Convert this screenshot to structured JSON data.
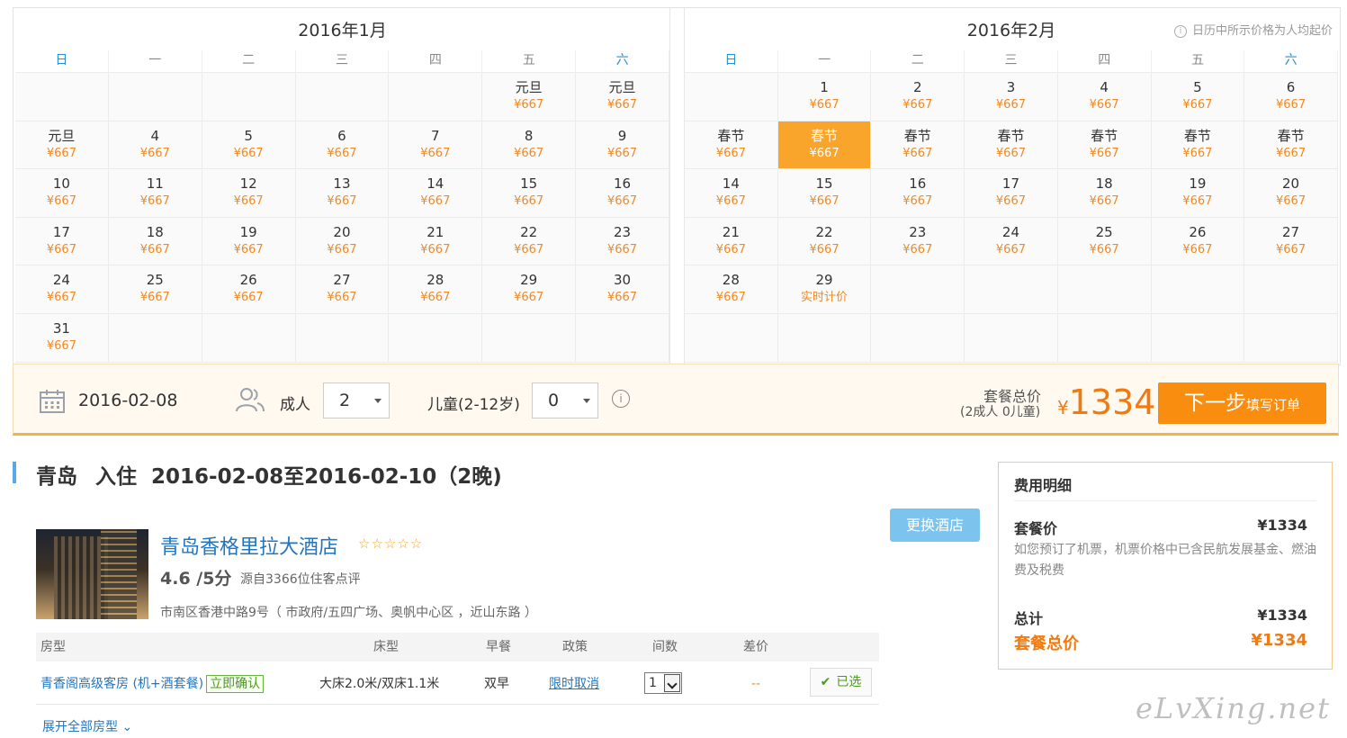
{
  "calendar": {
    "note": "日历中所示价格为人均起价",
    "weekdays": [
      "日",
      "一",
      "二",
      "三",
      "四",
      "五",
      "六"
    ],
    "months": [
      {
        "title": "2016年1月",
        "cells": [
          {
            "d": "",
            "p": ""
          },
          {
            "d": "",
            "p": ""
          },
          {
            "d": "",
            "p": ""
          },
          {
            "d": "",
            "p": ""
          },
          {
            "d": "",
            "p": ""
          },
          {
            "d": "元旦",
            "p": "¥667"
          },
          {
            "d": "元旦",
            "p": "¥667"
          },
          {
            "d": "元旦",
            "p": "¥667"
          },
          {
            "d": "4",
            "p": "¥667"
          },
          {
            "d": "5",
            "p": "¥667"
          },
          {
            "d": "6",
            "p": "¥667"
          },
          {
            "d": "7",
            "p": "¥667"
          },
          {
            "d": "8",
            "p": "¥667"
          },
          {
            "d": "9",
            "p": "¥667"
          },
          {
            "d": "10",
            "p": "¥667"
          },
          {
            "d": "11",
            "p": "¥667"
          },
          {
            "d": "12",
            "p": "¥667"
          },
          {
            "d": "13",
            "p": "¥667"
          },
          {
            "d": "14",
            "p": "¥667"
          },
          {
            "d": "15",
            "p": "¥667"
          },
          {
            "d": "16",
            "p": "¥667"
          },
          {
            "d": "17",
            "p": "¥667"
          },
          {
            "d": "18",
            "p": "¥667"
          },
          {
            "d": "19",
            "p": "¥667"
          },
          {
            "d": "20",
            "p": "¥667"
          },
          {
            "d": "21",
            "p": "¥667"
          },
          {
            "d": "22",
            "p": "¥667"
          },
          {
            "d": "23",
            "p": "¥667"
          },
          {
            "d": "24",
            "p": "¥667"
          },
          {
            "d": "25",
            "p": "¥667"
          },
          {
            "d": "26",
            "p": "¥667"
          },
          {
            "d": "27",
            "p": "¥667"
          },
          {
            "d": "28",
            "p": "¥667"
          },
          {
            "d": "29",
            "p": "¥667"
          },
          {
            "d": "30",
            "p": "¥667"
          },
          {
            "d": "31",
            "p": "¥667"
          },
          {
            "d": "",
            "p": ""
          },
          {
            "d": "",
            "p": ""
          },
          {
            "d": "",
            "p": ""
          },
          {
            "d": "",
            "p": ""
          },
          {
            "d": "",
            "p": ""
          },
          {
            "d": "",
            "p": ""
          }
        ]
      },
      {
        "title": "2016年2月",
        "cells": [
          {
            "d": "",
            "p": ""
          },
          {
            "d": "1",
            "p": "¥667"
          },
          {
            "d": "2",
            "p": "¥667"
          },
          {
            "d": "3",
            "p": "¥667"
          },
          {
            "d": "4",
            "p": "¥667"
          },
          {
            "d": "5",
            "p": "¥667"
          },
          {
            "d": "6",
            "p": "¥667"
          },
          {
            "d": "春节",
            "p": "¥667"
          },
          {
            "d": "春节",
            "p": "¥667",
            "selected": true
          },
          {
            "d": "春节",
            "p": "¥667"
          },
          {
            "d": "春节",
            "p": "¥667"
          },
          {
            "d": "春节",
            "p": "¥667"
          },
          {
            "d": "春节",
            "p": "¥667"
          },
          {
            "d": "春节",
            "p": "¥667"
          },
          {
            "d": "14",
            "p": "¥667"
          },
          {
            "d": "15",
            "p": "¥667"
          },
          {
            "d": "16",
            "p": "¥667"
          },
          {
            "d": "17",
            "p": "¥667"
          },
          {
            "d": "18",
            "p": "¥667"
          },
          {
            "d": "19",
            "p": "¥667"
          },
          {
            "d": "20",
            "p": "¥667"
          },
          {
            "d": "21",
            "p": "¥667"
          },
          {
            "d": "22",
            "p": "¥667"
          },
          {
            "d": "23",
            "p": "¥667"
          },
          {
            "d": "24",
            "p": "¥667"
          },
          {
            "d": "25",
            "p": "¥667"
          },
          {
            "d": "26",
            "p": "¥667"
          },
          {
            "d": "27",
            "p": "¥667"
          },
          {
            "d": "28",
            "p": "¥667"
          },
          {
            "d": "29",
            "p": "实时计价"
          },
          {
            "d": "",
            "p": ""
          },
          {
            "d": "",
            "p": ""
          },
          {
            "d": "",
            "p": ""
          },
          {
            "d": "",
            "p": ""
          },
          {
            "d": "",
            "p": ""
          },
          {
            "d": "",
            "p": ""
          },
          {
            "d": "",
            "p": ""
          },
          {
            "d": "",
            "p": ""
          },
          {
            "d": "",
            "p": ""
          },
          {
            "d": "",
            "p": ""
          },
          {
            "d": "",
            "p": ""
          },
          {
            "d": "",
            "p": ""
          }
        ]
      }
    ]
  },
  "booking": {
    "date": "2016-02-08",
    "adult_label": "成人",
    "adult_value": "2",
    "child_label": "儿童(2-12岁)",
    "child_value": "0",
    "total_label": "套餐总价",
    "total_sub": "(2成人 0儿童)",
    "currency": "¥",
    "total_price": "1334",
    "next_label": "下一步",
    "next_sub": "填写订单"
  },
  "hotel_section": {
    "city": "青岛",
    "checkin_label": "入住",
    "dates": "2016-02-08至2016-02-10（2晚)",
    "hotel_name": "青岛香格里拉大酒店",
    "stars": "☆☆☆☆☆",
    "score": "4.6 /5分",
    "reviews": "源自3366位住客点评",
    "address": "市南区香港中路9号（ 市政府/五四广场、奥帆中心区 ，近山东路 ）",
    "change_label": "更换酒店",
    "table_headers": [
      "房型",
      "床型",
      "早餐",
      "政策",
      "间数",
      "差价"
    ],
    "room": {
      "name": "青香阁高级客房 (机+酒套餐)",
      "confirm": "立即确认",
      "bed": "大床2.0米/双床1.1米",
      "breakfast": "双早",
      "policy": "限时取消",
      "qty": "1",
      "diff": "--",
      "chosen": "已选"
    },
    "expand_label": "展开全部房型"
  },
  "fee": {
    "title": "费用明细",
    "package_label": "套餐价",
    "package_value": "¥1334",
    "note": "如您预订了机票，机票价格中已含民航发展基金、燃油费及税费",
    "sum_label": "总计",
    "sum_value": "¥1334",
    "total_label": "套餐总价",
    "total_value": "¥1334"
  },
  "watermark": "eLvXing.net",
  "colors": {
    "accent": "#f98d0f",
    "link": "#2276c0",
    "price": "#f08a24",
    "selected": "#f9a52b"
  }
}
